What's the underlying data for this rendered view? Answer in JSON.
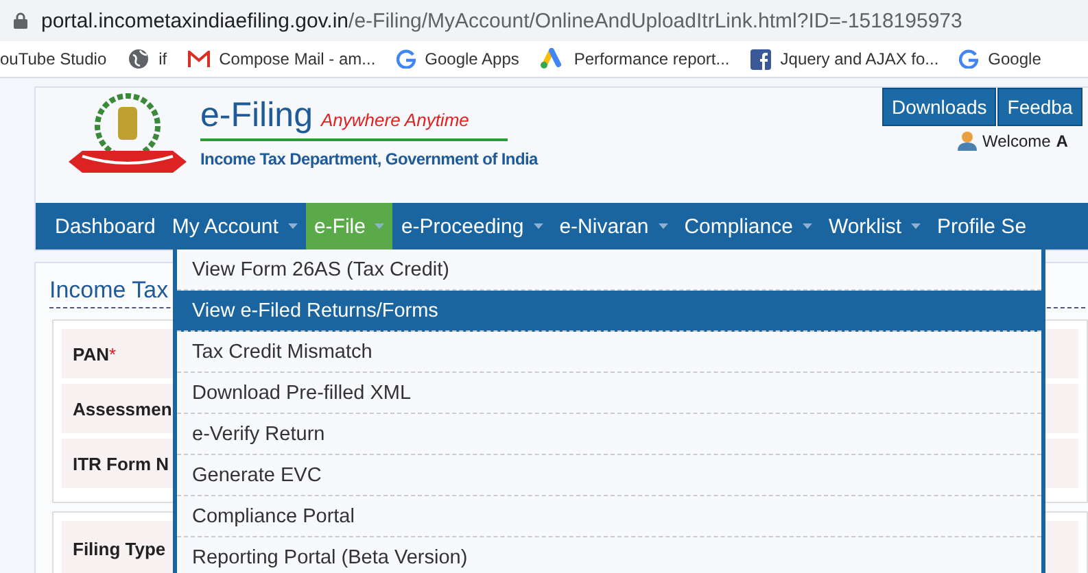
{
  "browser": {
    "url_domain": "portal.incometaxindiaefiling.gov.in",
    "url_path": "/e-Filing/MyAccount/OnlineAndUploadItrLink.html?ID=-1518195973",
    "bookmarks": [
      {
        "label": "ouTube Studio",
        "kind": "none"
      },
      {
        "label": "if",
        "kind": "globe"
      },
      {
        "label": "Compose Mail - am...",
        "kind": "mail"
      },
      {
        "label": "Google Apps",
        "kind": "google"
      },
      {
        "label": "Performance report...",
        "kind": "ads"
      },
      {
        "label": "Jquery and AJAX fo...",
        "kind": "facebook"
      },
      {
        "label": "Google",
        "kind": "google"
      }
    ]
  },
  "header": {
    "brand": "e-Filing",
    "tagline": "Anywhere Anytime",
    "subtitle": "Income Tax Department, Government of India",
    "top_buttons": [
      "Downloads",
      "Feedba"
    ],
    "welcome": "Welcome",
    "user": "A"
  },
  "nav": [
    {
      "label": "Dashboard",
      "dropdown": false,
      "selected": false
    },
    {
      "label": "My Account",
      "dropdown": true,
      "selected": false
    },
    {
      "label": "e-File",
      "dropdown": true,
      "selected": true
    },
    {
      "label": "e-Proceeding",
      "dropdown": true,
      "selected": false
    },
    {
      "label": "e-Nivaran",
      "dropdown": true,
      "selected": false
    },
    {
      "label": "Compliance",
      "dropdown": true,
      "selected": false
    },
    {
      "label": "Worklist",
      "dropdown": true,
      "selected": false
    },
    {
      "label": "Profile Se",
      "dropdown": false,
      "selected": false
    }
  ],
  "menu": [
    {
      "label": "View Form 26AS (Tax Credit)",
      "selected": false
    },
    {
      "label": "View e-Filed Returns/Forms",
      "selected": true
    },
    {
      "label": "Tax Credit Mismatch",
      "selected": false
    },
    {
      "label": "Download Pre-filled XML",
      "selected": false
    },
    {
      "label": "e-Verify Return",
      "selected": false
    },
    {
      "label": "Generate EVC",
      "selected": false
    },
    {
      "label": "Compliance Portal",
      "selected": false
    },
    {
      "label": "Reporting Portal (Beta Version)",
      "selected": false
    }
  ],
  "form": {
    "title": "Income Tax",
    "fields": [
      {
        "label": "PAN",
        "required_mark": "*"
      },
      {
        "label": "Assessmen"
      },
      {
        "label": "ITR Form N"
      }
    ],
    "section_field": "Filing Type"
  }
}
